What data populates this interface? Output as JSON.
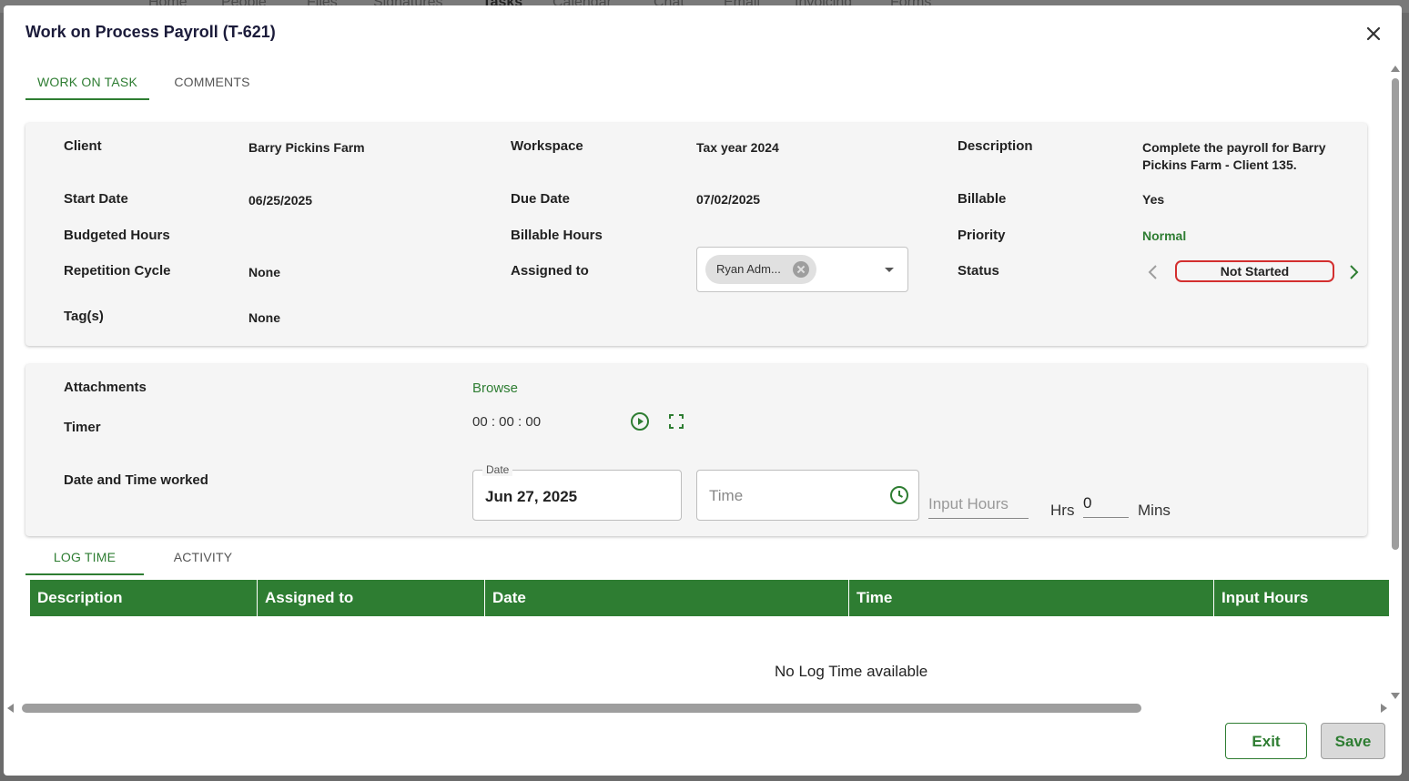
{
  "background_nav": [
    "Home",
    "People",
    "Files",
    "Signatures",
    "Tasks",
    "Calendar",
    "Chat",
    "Email",
    "Invoicing",
    "Forms"
  ],
  "modal": {
    "title": "Work on Process Payroll (T-621)"
  },
  "tabs": [
    "WORK ON TASK",
    "COMMENTS"
  ],
  "details": {
    "client_label": "Client",
    "client_value": "Barry Pickins Farm",
    "workspace_label": "Workspace",
    "workspace_value": "Tax year 2024",
    "description_label": "Description",
    "description_value_line1": "Complete the payroll for Barry",
    "description_value_line2": "Pickins Farm - Client 135.",
    "start_date_label": "Start Date",
    "start_date_value": "06/25/2025",
    "due_date_label": "Due Date",
    "due_date_value": "07/02/2025",
    "billable_label": "Billable",
    "billable_value": "Yes",
    "budgeted_hours_label": "Budgeted Hours",
    "billable_hours_label": "Billable Hours",
    "priority_label": "Priority",
    "priority_value": "Normal",
    "repetition_label": "Repetition Cycle",
    "repetition_value": "None",
    "assigned_label": "Assigned to",
    "assigned_chip": "Ryan Adm...",
    "status_label": "Status",
    "status_value": "Not Started",
    "tags_label": "Tag(s)",
    "tags_value": "None"
  },
  "work": {
    "attachments_label": "Attachments",
    "browse": "Browse",
    "timer_label": "Timer",
    "timer_value": "00 : 00 : 00",
    "date_time_label": "Date and Time worked",
    "date_legend": "Date",
    "date_value": "Jun 27, 2025",
    "time_placeholder": "Time",
    "input_hours_placeholder": "Input Hours",
    "hrs_unit": "Hrs",
    "mins_value": "0",
    "mins_unit": "Mins"
  },
  "log_tabs": [
    "LOG TIME",
    "ACTIVITY"
  ],
  "table": {
    "columns": [
      "Description",
      "Assigned to",
      "Date",
      "Time",
      "Input Hours"
    ],
    "empty": "No Log Time available"
  },
  "buttons": {
    "exit": "Exit",
    "save": "Save"
  },
  "colors": {
    "accent": "#2e7d32",
    "status_border": "#d32f2f",
    "priority": "#2e7d32"
  }
}
